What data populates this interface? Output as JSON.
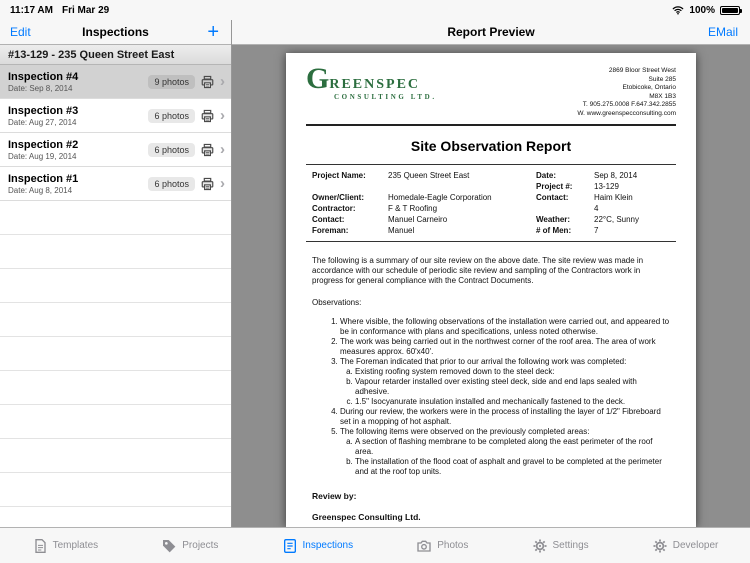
{
  "status_bar": {
    "time": "11:17 AM",
    "date": "Fri Mar 29",
    "battery_percent": "100%"
  },
  "sidebar": {
    "edit_label": "Edit",
    "title": "Inspections",
    "add_label": "+",
    "section_header": "#13-129 - 235 Queen Street East",
    "items": [
      {
        "title": "Inspection #4",
        "date": "Date: Sep 8, 2014",
        "photos": "9 photos",
        "selected": true
      },
      {
        "title": "Inspection #3",
        "date": "Date: Aug 27, 2014",
        "photos": "6 photos",
        "selected": false
      },
      {
        "title": "Inspection #2",
        "date": "Date: Aug 19, 2014",
        "photos": "6 photos",
        "selected": false
      },
      {
        "title": "Inspection #1",
        "date": "Date: Aug 8, 2014",
        "photos": "6 photos",
        "selected": false
      }
    ]
  },
  "preview": {
    "title": "Report Preview",
    "email_label": "EMail",
    "document": {
      "logo_g": "G",
      "logo_name": "REENSPEC",
      "logo_sub": "CONSULTING LTD.",
      "address_lines": [
        "2869 Bloor Street West",
        "Suite 285",
        "Etobicoke, Ontario",
        "M8X 1B3",
        "T. 905.275.0008  F.647.342.2855",
        "W. www.greenspecconsulting.com"
      ],
      "report_title": "Site Observation Report",
      "field_rows": [
        {
          "left_label": "Project Name:",
          "left_value": "235 Queen Street East",
          "right_label": "Date:",
          "right_value": "Sep 8, 2014"
        },
        {
          "left_label": "",
          "left_value": "",
          "right_label": "Project #:",
          "right_value": "13-129"
        },
        {
          "left_label": "Owner/Client:",
          "left_value": "Homedale-Eagle Corporation",
          "right_label": "Contact:",
          "right_value": "Haim Klein"
        },
        {
          "left_label": "Contractor:",
          "left_value": "F & T Roofing",
          "right_label": "",
          "right_value": "4"
        },
        {
          "left_label": "Contact:",
          "left_value": "Manuel Carneiro",
          "right_label": "Weather:",
          "right_value": "22°C, Sunny"
        },
        {
          "left_label": "Foreman:",
          "left_value": "Manuel",
          "right_label": "# of Men:",
          "right_value": "7"
        }
      ],
      "intro": "The following is a summary of our site review on the above date. The site review was made in accordance with our schedule of periodic site review and sampling of the Contractors work in progress for general compliance with the Contract Documents.",
      "observations_label": "Observations:",
      "observations": [
        {
          "text": "Where visible, the following observations of the installation were carried out, and appeared to be in conformance with plans and specifications, unless noted otherwise.",
          "sub": []
        },
        {
          "text": "The work was being carried out in the northwest corner of the roof area.  The area of work measures approx. 60'x40'.",
          "sub": []
        },
        {
          "text": "The Foreman indicated that prior to our arrival the following work was completed:",
          "sub": [
            "Existing roofing system removed down to the steel deck:",
            "Vapour retarder installed over existing steel deck, side and end laps sealed with adhesive.",
            "1.5\" Isocyanurate insulation installed and mechanically fastened to the deck."
          ]
        },
        {
          "text": "During our review, the workers were in the process of installing the layer of 1/2\" Fibreboard set in a mopping of hot asphalt.",
          "sub": []
        },
        {
          "text": "The following items were observed on the previously completed areas:",
          "sub": [
            "A section of flashing membrane to be completed along the east perimeter of the roof area.",
            "The installation of the flood coat of asphalt and gravel to be completed at the perimeter and at the roof top units."
          ]
        }
      ],
      "review_by_label": "Review by:",
      "company_signature": "Greenspec Consulting Ltd."
    }
  },
  "tab_bar": {
    "tabs": [
      {
        "label": "Templates",
        "icon": "templates-icon",
        "active": false
      },
      {
        "label": "Projects",
        "icon": "projects-icon",
        "active": false
      },
      {
        "label": "Inspections",
        "icon": "inspections-icon",
        "active": true
      },
      {
        "label": "Photos",
        "icon": "photos-icon",
        "active": false
      },
      {
        "label": "Settings",
        "icon": "settings-icon",
        "active": false
      },
      {
        "label": "Developer",
        "icon": "developer-icon",
        "active": false
      }
    ]
  },
  "colors": {
    "accent": "#007aff",
    "logo_green": "#2c6e3f"
  }
}
